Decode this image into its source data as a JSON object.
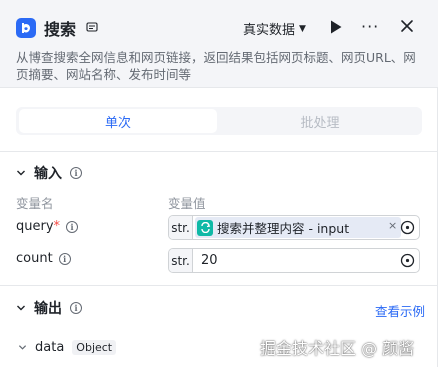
{
  "header": {
    "title": "搜索",
    "mode_label": "真实数据",
    "more_label": "···",
    "description": "从博查搜索全网信息和网页链接，返回结果包括网页标题、网页URL、网页摘要、网站名称、发布时间等"
  },
  "tabs": [
    {
      "label": "单次",
      "active": true
    },
    {
      "label": "批处理",
      "active": false
    }
  ],
  "input": {
    "title": "输入",
    "col_name": "变量名",
    "col_value": "变量值",
    "rows": [
      {
        "name": "query",
        "required_mark": "*",
        "type": "str.",
        "ref_text": "搜索并整理内容 - input",
        "clear_label": "×"
      },
      {
        "name": "count",
        "required_mark": "",
        "type": "str.",
        "value": "20"
      }
    ]
  },
  "output": {
    "title": "输出",
    "example_link": "查看示例",
    "items": [
      {
        "name": "data",
        "type": "Object"
      }
    ]
  },
  "watermark": "掘金技术社区 @ 颜酱",
  "colors": {
    "accent": "#2b6af5",
    "required": "#f54a45",
    "ref_icon": "#0fb9a6"
  }
}
